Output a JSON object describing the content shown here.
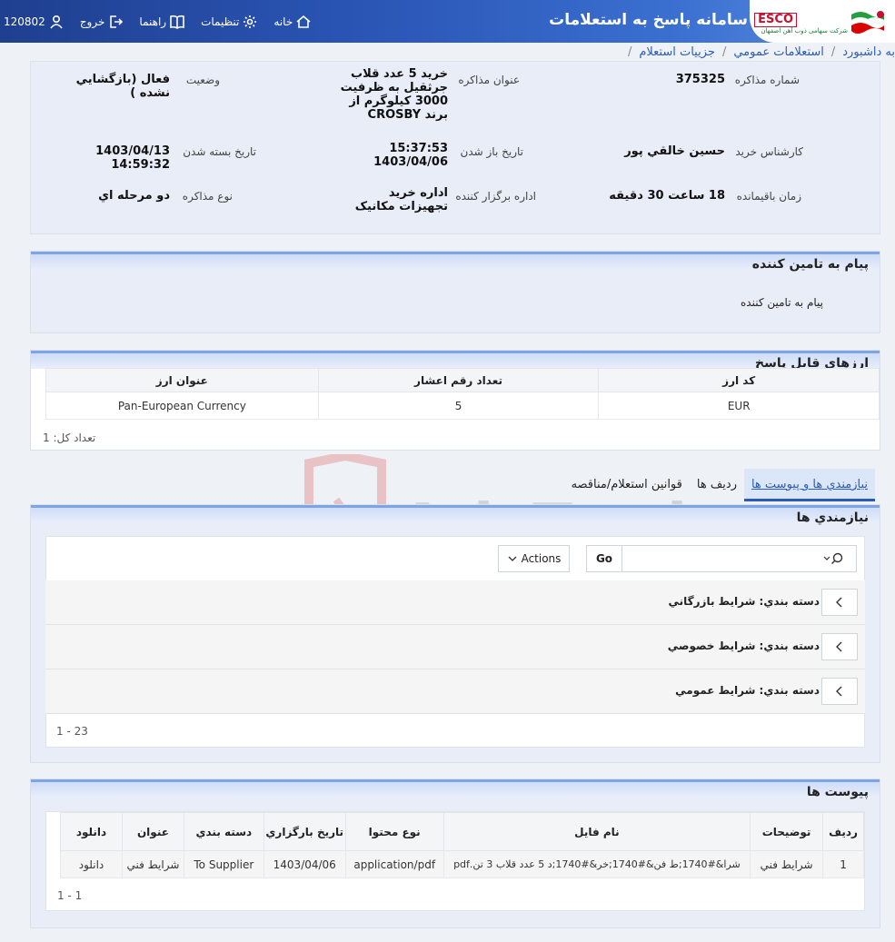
{
  "header": {
    "app_title": "سامانه پاسخ به استعلامات",
    "logo_text": "ESCO",
    "logo_sub": "شرکت سهامی ذوب آهن اصفهان",
    "nav": {
      "home": "خانه",
      "settings": "تنظيمات",
      "guide": "راهنما",
      "logout": "خروج",
      "user_id": "120802"
    }
  },
  "breadcrumb": [
    "به داشبورد",
    "استعلامات عمومي",
    "جزييات استعلام"
  ],
  "info": {
    "number_label": "شماره مذاکره",
    "number_value": "375325",
    "subject_label": "عنوان مذاکره",
    "subject_value": "خريد 5 عدد قلاب جرثقيل به ظرفيت 3000 کيلوگرم از برند CROSBY",
    "status_label": "وضعيت",
    "status_value": "فعال (بازگشايي نشده )",
    "expert_label": "کارشناس خريد",
    "expert_value": "حسين خالقي پور",
    "open_label": "تاريخ باز شدن",
    "open_time": "15:37:53",
    "open_date": "1403/04/06",
    "close_label": "تاريخ بسته شدن",
    "close_value": "1403/04/13 14:59:32",
    "remaining_label": "زمان باقيمانده",
    "remaining_value": "18 ساعت 30 دقيقه",
    "dept_label": "اداره برگزار کننده",
    "dept_value": "اداره خريد تجهيزات مکانيک",
    "type_label": "نوع مذاکره",
    "type_value": "دو مرحله اي"
  },
  "message": {
    "title": "پيام به تامين کننده",
    "body": "پيام به تامين کننده"
  },
  "currencies": {
    "title": "ارزهاي قابل پاسخ",
    "headers": [
      "کد ارز",
      "تعداد رقم اعشار",
      "عنوان ارز"
    ],
    "rows": [
      [
        "EUR",
        "5",
        "Pan-European Currency"
      ]
    ],
    "total": "تعداد کل: 1"
  },
  "tabs": [
    "نيازمندي ها و پيوست ها",
    "رديف ها",
    "قوانين استعلام/مناقصه"
  ],
  "requirements": {
    "title": "نيازمندي ها",
    "go_label": "Go",
    "actions_label": "Actions",
    "groups": [
      "دسته بندي: شرايط بازرگاني",
      "دسته بندي: شرايط خصوصي",
      "دسته بندي: شرايط عمومي"
    ],
    "pagination": "1 - 23"
  },
  "attachments": {
    "title": "پيوست ها",
    "headers": [
      "رديف",
      "توضيحات",
      "نام فايل",
      "نوع محتوا",
      "تاريخ بارگزاري",
      "دسته بندي",
      "عنوان",
      "دانلود"
    ],
    "rows": [
      [
        "1",
        "شرايط فني",
        "شرا&#1740;ط فن&#1740;خر&#1740;د 5 عدد قلاب 3 تن.pdf",
        "application/pdf",
        "1403/04/06",
        "To Supplier",
        "شرايط فني",
        "دانلود"
      ]
    ],
    "pagination": "1 - 1"
  },
  "watermark": "AriaTender.neT",
  "colors": {
    "header_start": "#1f3f8f",
    "header_end": "#5d8fe0",
    "link": "#2a5bb8",
    "section_border": "#7da4e6",
    "watermark": "#d9534f"
  }
}
